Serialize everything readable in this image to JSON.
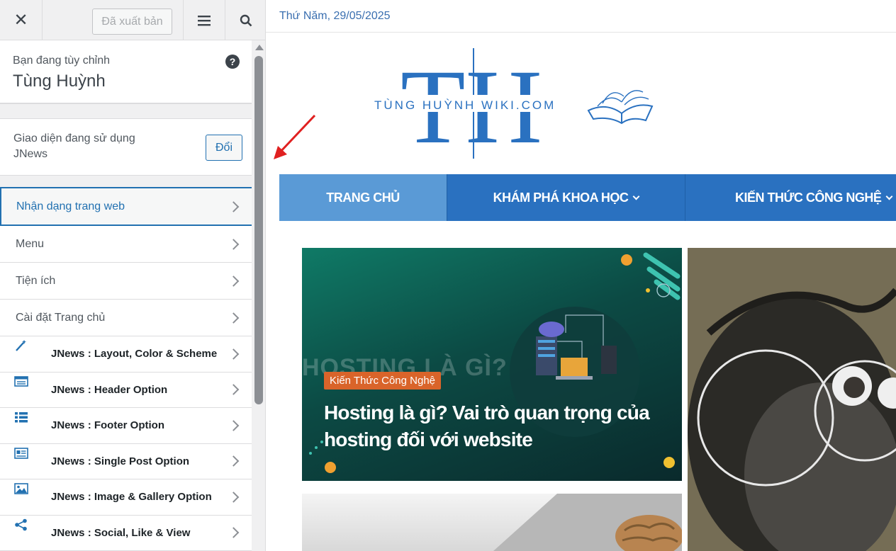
{
  "sidebar": {
    "close_label": "✕",
    "publish_label": "Đã xuất bản",
    "customizing_label": "Bạn đang tùy chỉnh",
    "site_name": "Tùng Huỳnh",
    "help_label": "?",
    "theme_label": "Giao diện đang sử dụng",
    "theme_name": "JNews",
    "change_label": "Đổi",
    "items": [
      {
        "label": "Nhận dạng trang web"
      },
      {
        "label": "Menu"
      },
      {
        "label": "Tiện ích"
      },
      {
        "label": "Cài đặt Trang chủ"
      }
    ],
    "jnews_items": [
      {
        "label": "JNews : Layout, Color & Scheme",
        "icon": "magic-wand-icon"
      },
      {
        "label": "JNews : Header Option",
        "icon": "header-icon"
      },
      {
        "label": "JNews : Footer Option",
        "icon": "list-icon"
      },
      {
        "label": "JNews : Single Post Option",
        "icon": "post-icon"
      },
      {
        "label": "JNews : Image & Gallery Option",
        "icon": "image-icon"
      },
      {
        "label": "JNews : Social, Like & View",
        "icon": "share-icon"
      }
    ]
  },
  "preview": {
    "date": "Thứ Năm, 29/05/2025",
    "logo_letters": "TH",
    "logo_text": "TÙNG HUỲNH WIKI.COM",
    "nav": [
      {
        "label": "TRANG CHỦ"
      },
      {
        "label": "KHÁM PHÁ KHOA HỌC"
      },
      {
        "label": "KIẾN THỨC CÔNG NGHỆ"
      }
    ],
    "featured": {
      "ghost_text": "HOSTING LÀ GÌ?",
      "category": "Kiến Thức Công Nghệ",
      "title": "Hosting là gì? Vai trò quan trọng của hosting đối với website"
    }
  },
  "colors": {
    "accent": "#2271b1",
    "nav_blue": "#2a71c0",
    "badge_orange": "#d9642a",
    "arrow_red": "#e02020"
  }
}
